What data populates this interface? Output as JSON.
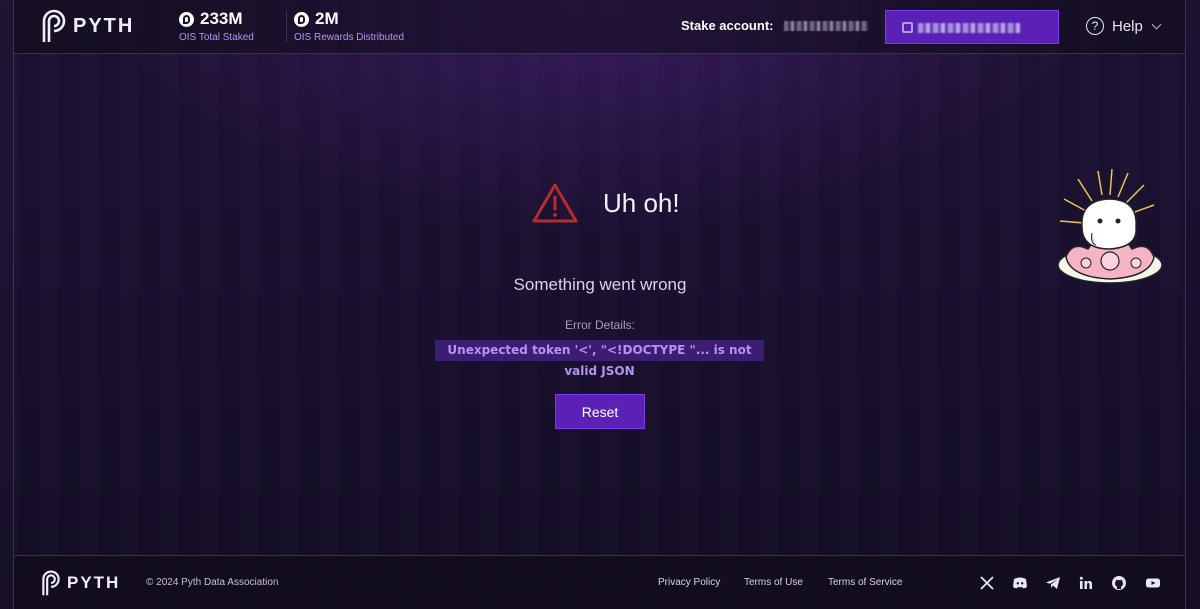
{
  "header": {
    "brand": "PYTH",
    "stats": [
      {
        "value": "233M",
        "caption": "OIS Total Staked"
      },
      {
        "value": "2M",
        "caption": "OIS Rewards Distributed"
      }
    ],
    "stake_account_label": "Stake account:",
    "help_label": "Help"
  },
  "error": {
    "title": "Uh oh!",
    "subtitle": "Something went wrong",
    "details_label": "Error Details:",
    "details": "Unexpected token '<', \"<!DOCTYPE \"... is not valid JSON",
    "reset_label": "Reset"
  },
  "footer": {
    "brand": "PYTH",
    "copyright": "© 2024 Pyth Data Association",
    "links": [
      "Privacy Policy",
      "Terms of Use",
      "Terms of Service"
    ],
    "social_icons": [
      "x-icon",
      "discord-icon",
      "telegram-icon",
      "linkedin-icon",
      "github-icon",
      "youtube-icon"
    ]
  },
  "colors": {
    "accent": "#5b21b6",
    "accent_border": "#7c3aed",
    "caption": "#b495f2",
    "warning": "#b22f2f",
    "code_bg": "#3b1d72",
    "code_text": "#b593f5"
  }
}
